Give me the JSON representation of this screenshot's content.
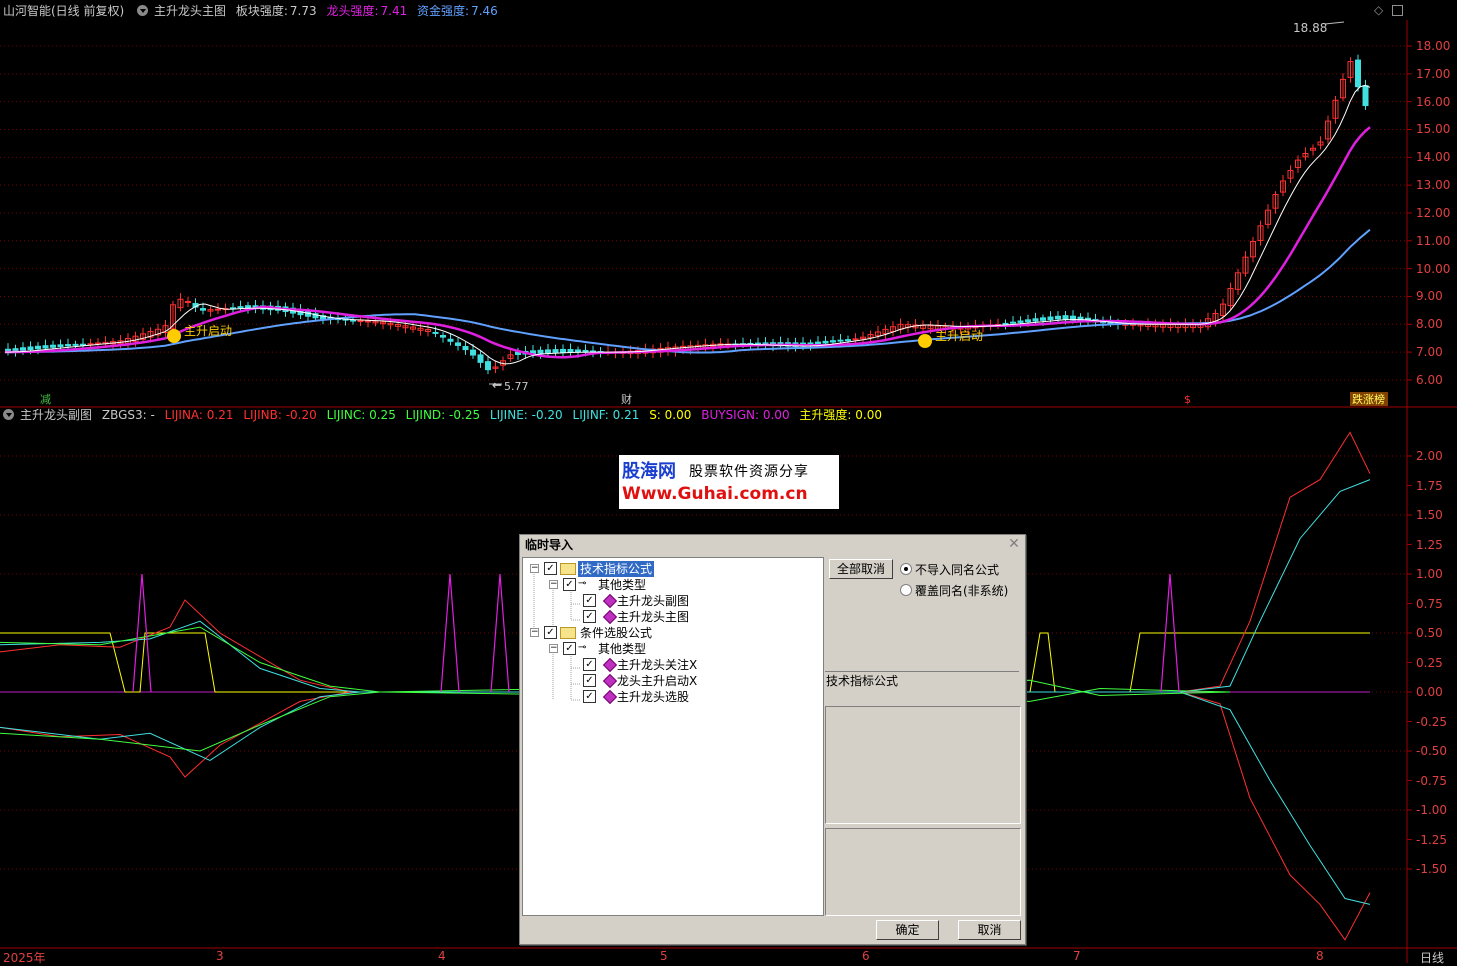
{
  "colors": {
    "up": "#ff3030",
    "down": "#40e0e0",
    "ma_white": "#ffffff",
    "ma_magenta": "#e020e0",
    "ma_blue": "#60a0ff",
    "grid": "#7a0000",
    "accent_yellow": "#ffff00"
  },
  "main_header": {
    "stock": "山河智能(日线 前复权)",
    "indicator": "主升龙头主图",
    "sector_label": "板块强度:",
    "sector_value": "7.73",
    "dragon_label": "龙头强度:",
    "dragon_value": "7.41",
    "fund_label": "资金强度:",
    "fund_value": "7.46"
  },
  "main_axis": [
    "18.00",
    "17.00",
    "16.00",
    "15.00",
    "14.00",
    "13.00",
    "12.00",
    "11.00",
    "10.00",
    "9.00",
    "8.00",
    "7.00",
    "6.00"
  ],
  "main_annotations": {
    "high": "18.88",
    "low": "5.77",
    "signal1": "主升启动",
    "signal2": "主升启动",
    "marker_left": "减",
    "marker_mid": "财",
    "marker_right": "$",
    "marker_end": "跌涨榜"
  },
  "sub_header": {
    "name": "主升龙头副图",
    "zbgs": "ZBGS3: -",
    "lijina": "LIJINA: 0.21",
    "lijinb": "LIJINB: -0.20",
    "lijinc": "LIJINC: 0.25",
    "lijind": "LIJIND: -0.25",
    "lijine": "LIJINE: -0.20",
    "lijinf": "LIJINF: 0.21",
    "s": "S: 0.00",
    "buysign": "BUYSIGN: 0.00",
    "strength": "主升强度: 0.00"
  },
  "sub_axis": [
    "2.00",
    "1.75",
    "1.50",
    "1.25",
    "1.00",
    "0.75",
    "0.50",
    "0.25",
    "0.00",
    "-0.25",
    "-0.50",
    "-0.75",
    "-1.00",
    "-1.25",
    "-1.50"
  ],
  "date_axis": {
    "year": "2025年",
    "m3": "3",
    "m4": "4",
    "m5": "5",
    "m6": "6",
    "m7": "7",
    "m8": "8",
    "period": "日线"
  },
  "ad": {
    "brand": "股海网",
    "tagline": "股票软件资源分享",
    "url": "Www.Guhai.com.cn"
  },
  "dialog": {
    "title": "临时导入",
    "tree": {
      "root1": "技术指标公式",
      "root1_sub": "其他类型",
      "root1_items": [
        "主升龙头副图",
        "主升龙头主图"
      ],
      "root2": "条件选股公式",
      "root2_sub": "其他类型",
      "root2_items": [
        "主升龙头关注X",
        "龙头主升启动X",
        "主升龙头选股"
      ]
    },
    "cancel_all": "全部取消",
    "opt_skip": "不导入同名公式",
    "opt_overwrite": "覆盖同名(非系统)",
    "info_label": "技术指标公式",
    "ok": "确定",
    "cancel": "取消"
  }
}
